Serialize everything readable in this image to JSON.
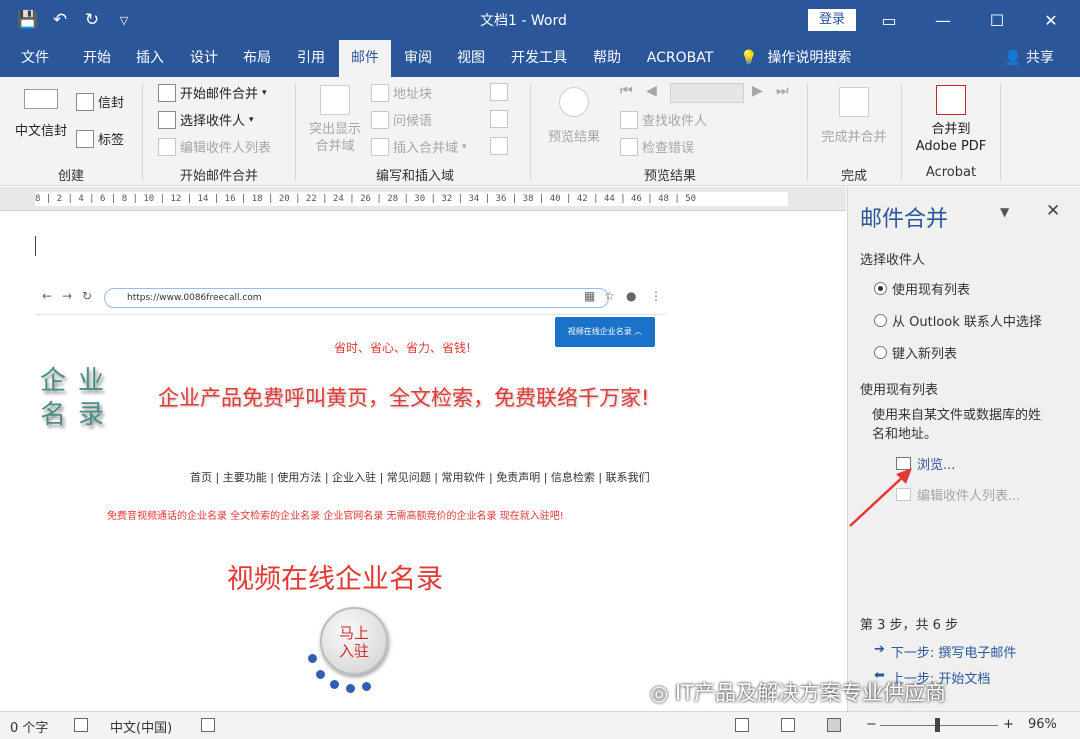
{
  "window": {
    "title": "文档1 - Word",
    "login_label": "登录"
  },
  "quick_access": {
    "icons": [
      "save-icon",
      "undo-icon",
      "redo-icon",
      "customize-icon"
    ]
  },
  "tabs": [
    "文件",
    "开始",
    "插入",
    "设计",
    "布局",
    "引用",
    "邮件",
    "审阅",
    "视图",
    "开发工具",
    "帮助",
    "ACROBAT"
  ],
  "active_tab": "邮件",
  "search_label": "操作说明搜索",
  "share_label": "共享",
  "ribbon": {
    "create": {
      "label": "创建",
      "chinese_envelope": "中文信封",
      "envelope": "信封",
      "labels": "标签"
    },
    "start_merge": {
      "label": "开始邮件合并",
      "start": "开始邮件合并",
      "select": "选择收件人",
      "edit": "编辑收件人列表"
    },
    "write_insert": {
      "label": "编写和插入域",
      "highlight": "突出显示\n合并域",
      "address_block": "地址块",
      "greeting": "问候语",
      "insert_field": "插入合并域"
    },
    "preview": {
      "label": "预览结果",
      "preview": "预览结果",
      "find": "查找收件人",
      "check": "检查错误"
    },
    "finish": {
      "label": "完成",
      "finish_merge": "完成并合并"
    },
    "acrobat": {
      "label": "Acrobat",
      "merge_pdf": "合并到\nAdobe PDF"
    }
  },
  "ruler_text": "8 | 2 | 4 | 6 | 8 | 10 | 12 | 14 | 16 | 18 | 20 | 22 | 24 | 26 | 28 | 30 | 32 | 34 | 36 | 38 | 40 | 42 | 44 | 46 | 48 | 50",
  "doc": {
    "url": "https://www.0086freecall.com",
    "chat_button": "视频在线企业名录",
    "slogan": "省时、省心、省力、省钱!",
    "logo_line1": "企业",
    "logo_line2": "名录",
    "headline": "企业产品免费呼叫黄页，全文检索，免费联络千万家!",
    "menu": "首页 | 主要功能 | 使用方法 | 企业入驻 | 常见问题 | 常用软件 | 免责声明 | 信息检索 | 联系我们",
    "red_line": "免费音视频通话的企业名录  全文检索的企业名录  企业官网名录  无需高额竞价的企业名录  现在就入驻吧!",
    "big_title": "视频在线企业名录",
    "circle_line1": "马上",
    "circle_line2": "入驻"
  },
  "panel": {
    "title": "邮件合并",
    "select_recipients": "选择收件人",
    "options": [
      "使用现有列表",
      "从 Outlook 联系人中选择",
      "键入新列表"
    ],
    "selected_option": 0,
    "use_existing": "使用现有列表",
    "description": "使用来自某文件或数据库的姓名和地址。",
    "browse": "浏览...",
    "edit_list": "编辑收件人列表...",
    "step": "第 3 步，共 6 步",
    "next": "下一步: 撰写电子邮件",
    "prev": "上一步: 开始文档"
  },
  "watermark": "IT产品及解决方案专业供应商",
  "status": {
    "word_count": "0 个字",
    "language": "中文(中国)",
    "zoom": "96%",
    "zoom_level": 0.48
  },
  "colors": {
    "brand": "#2b579a",
    "accent_red": "#e53935",
    "arrow": "#e53935"
  }
}
